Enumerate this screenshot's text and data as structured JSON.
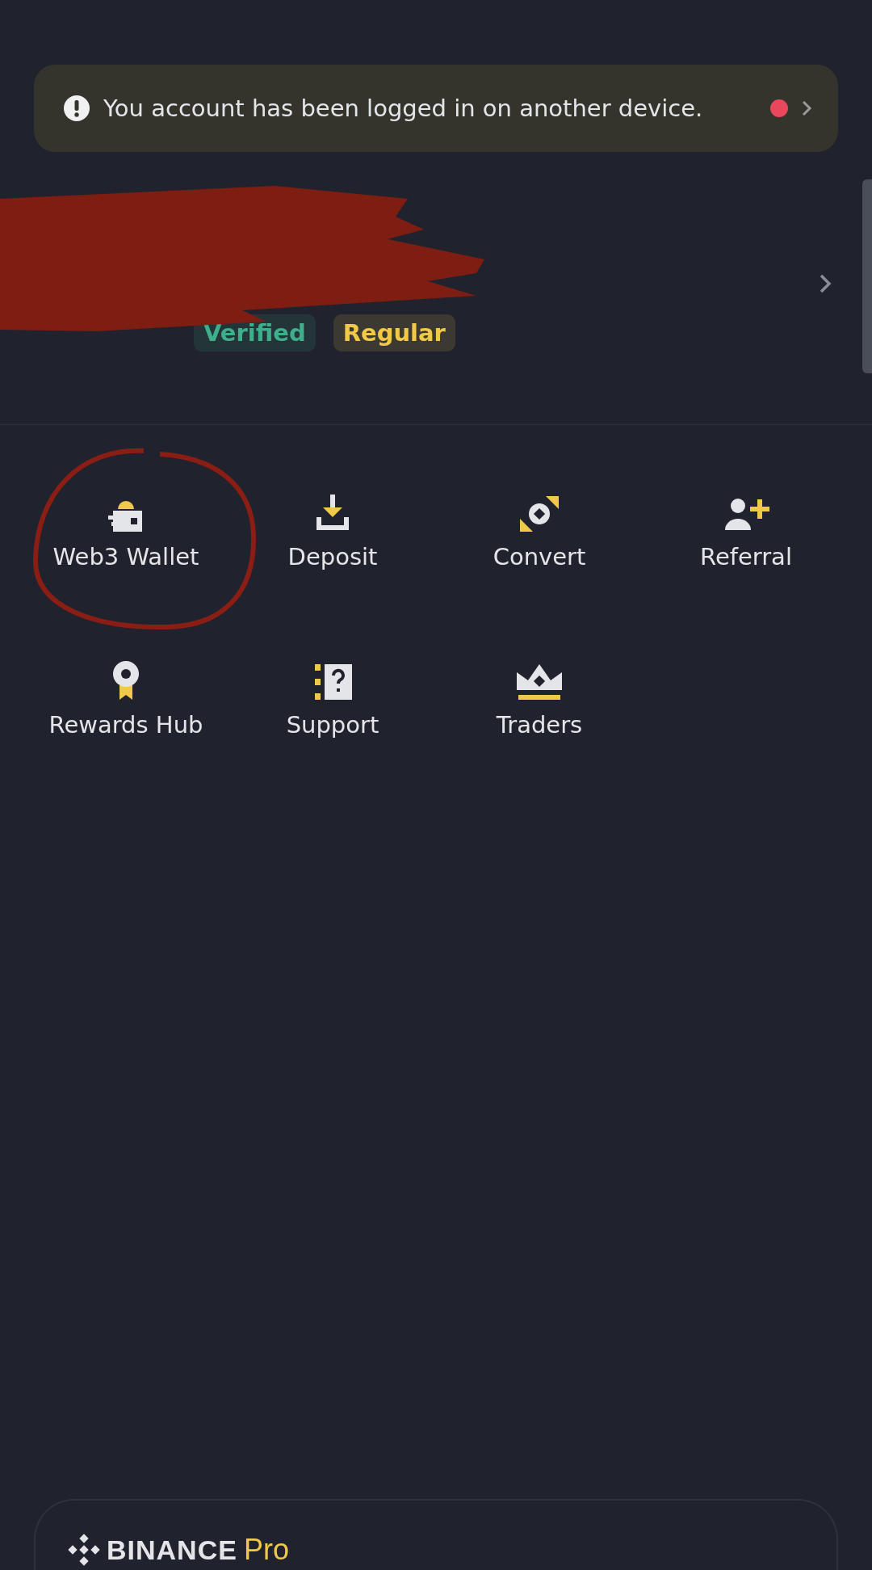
{
  "notice": {
    "text": "You account has been logged in on another device.",
    "unread": true
  },
  "profile": {
    "tags": [
      {
        "label": "Verified",
        "color": "#3fae8a"
      },
      {
        "label": "Regular",
        "color": "#f0c94a"
      }
    ]
  },
  "shortcuts": [
    {
      "label": "Web3 Wallet",
      "kind": "wallet"
    },
    {
      "label": "Deposit",
      "kind": "deposit"
    },
    {
      "label": "Convert",
      "kind": "convert"
    },
    {
      "label": "Referral",
      "kind": "referral"
    },
    {
      "label": "Rewards Hub",
      "kind": "rewards"
    },
    {
      "label": "Support",
      "kind": "support"
    },
    {
      "label": "Traders",
      "kind": "crown"
    }
  ],
  "footer": {
    "brand": "BINANCE",
    "product": "Pro"
  }
}
